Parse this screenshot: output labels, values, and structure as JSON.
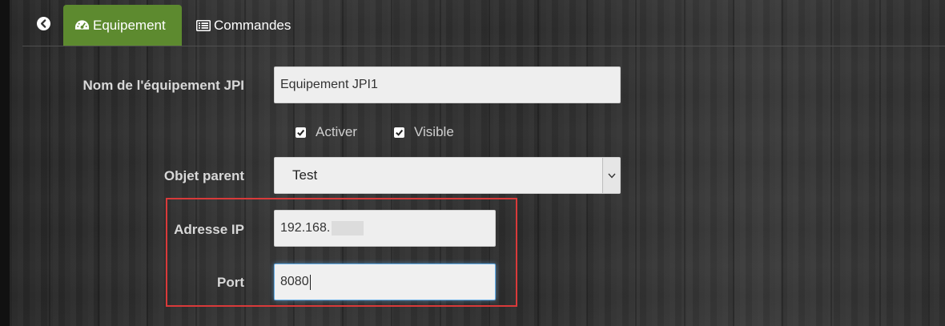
{
  "tabs": {
    "back_icon": "arrow-circle-left-icon",
    "equipement": {
      "label": "Equipement",
      "icon": "dashboard-icon",
      "active_color": "#5d8a2f"
    },
    "commandes": {
      "label": "Commandes",
      "icon": "list-icon"
    }
  },
  "form": {
    "name": {
      "label": "Nom de l'équipement JPI",
      "value": "Equipement JPI1"
    },
    "activer": {
      "label": "Activer",
      "checked": true
    },
    "visible": {
      "label": "Visible",
      "checked": true
    },
    "parent": {
      "label": "Objet parent",
      "value": "Test"
    },
    "ip": {
      "label": "Adresse IP",
      "value": "192.168."
    },
    "port": {
      "label": "Port",
      "value": "8080"
    }
  },
  "highlight_color": "#d93a3a"
}
